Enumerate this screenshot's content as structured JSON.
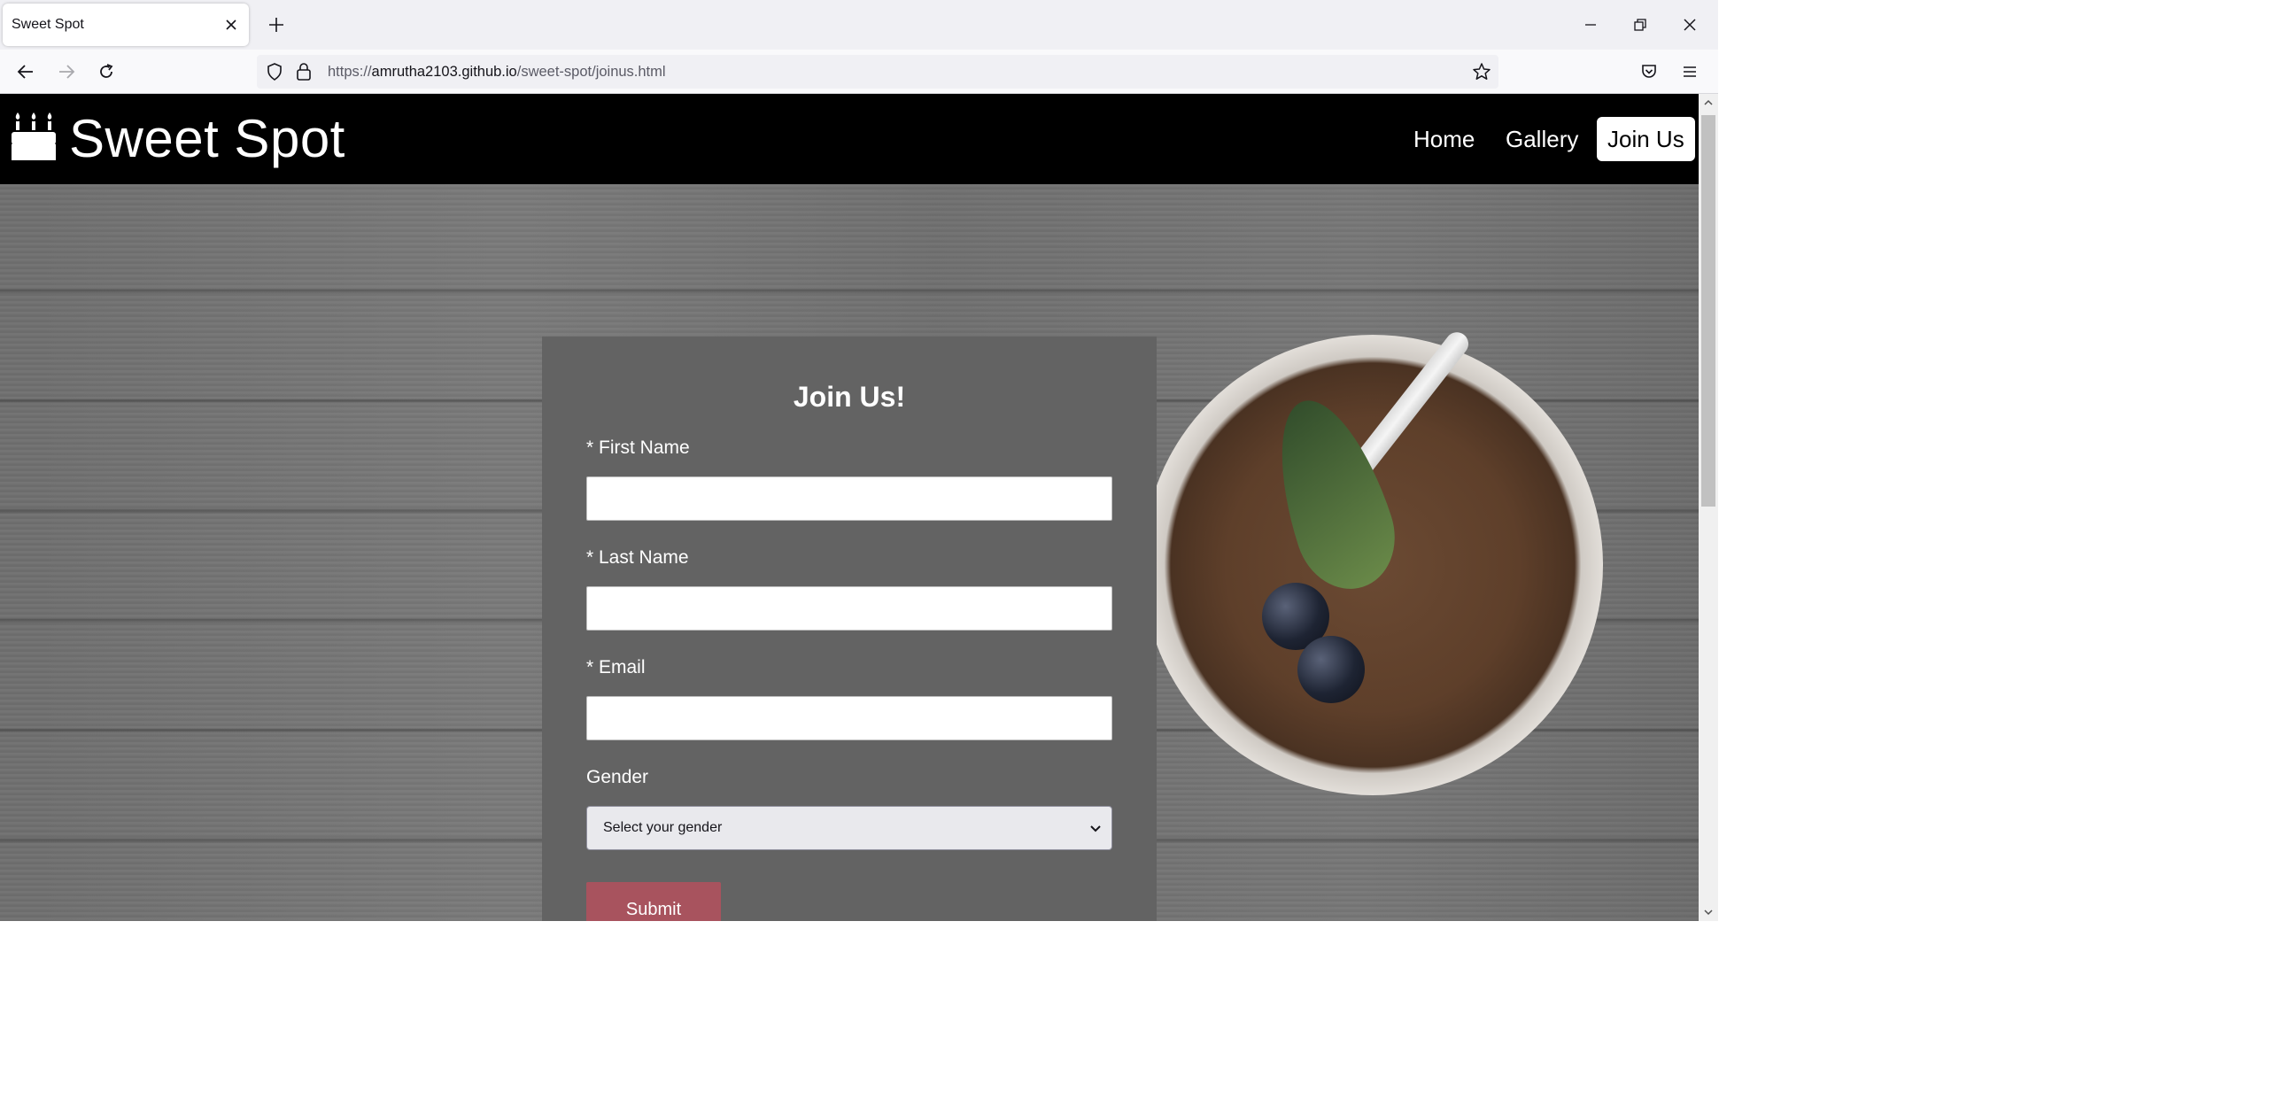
{
  "browser": {
    "tab_title": "Sweet Spot",
    "url_prefix": "https://",
    "url_host": "amrutha2103.github.io",
    "url_path": "/sweet-spot/joinus.html"
  },
  "site": {
    "brand": "Sweet Spot",
    "nav": [
      {
        "label": "Home"
      },
      {
        "label": "Gallery"
      },
      {
        "label": "Join Us",
        "active": true
      }
    ]
  },
  "form": {
    "title": "Join Us!",
    "first_name_label": "* First Name",
    "last_name_label": "* Last Name",
    "email_label": "* Email",
    "gender_label": "Gender",
    "gender_selected": "Select your gender",
    "submit_label": "Submit"
  },
  "colors": {
    "header_bg": "#000000",
    "card_bg": "#636363",
    "submit_bg": "#a8535e"
  }
}
